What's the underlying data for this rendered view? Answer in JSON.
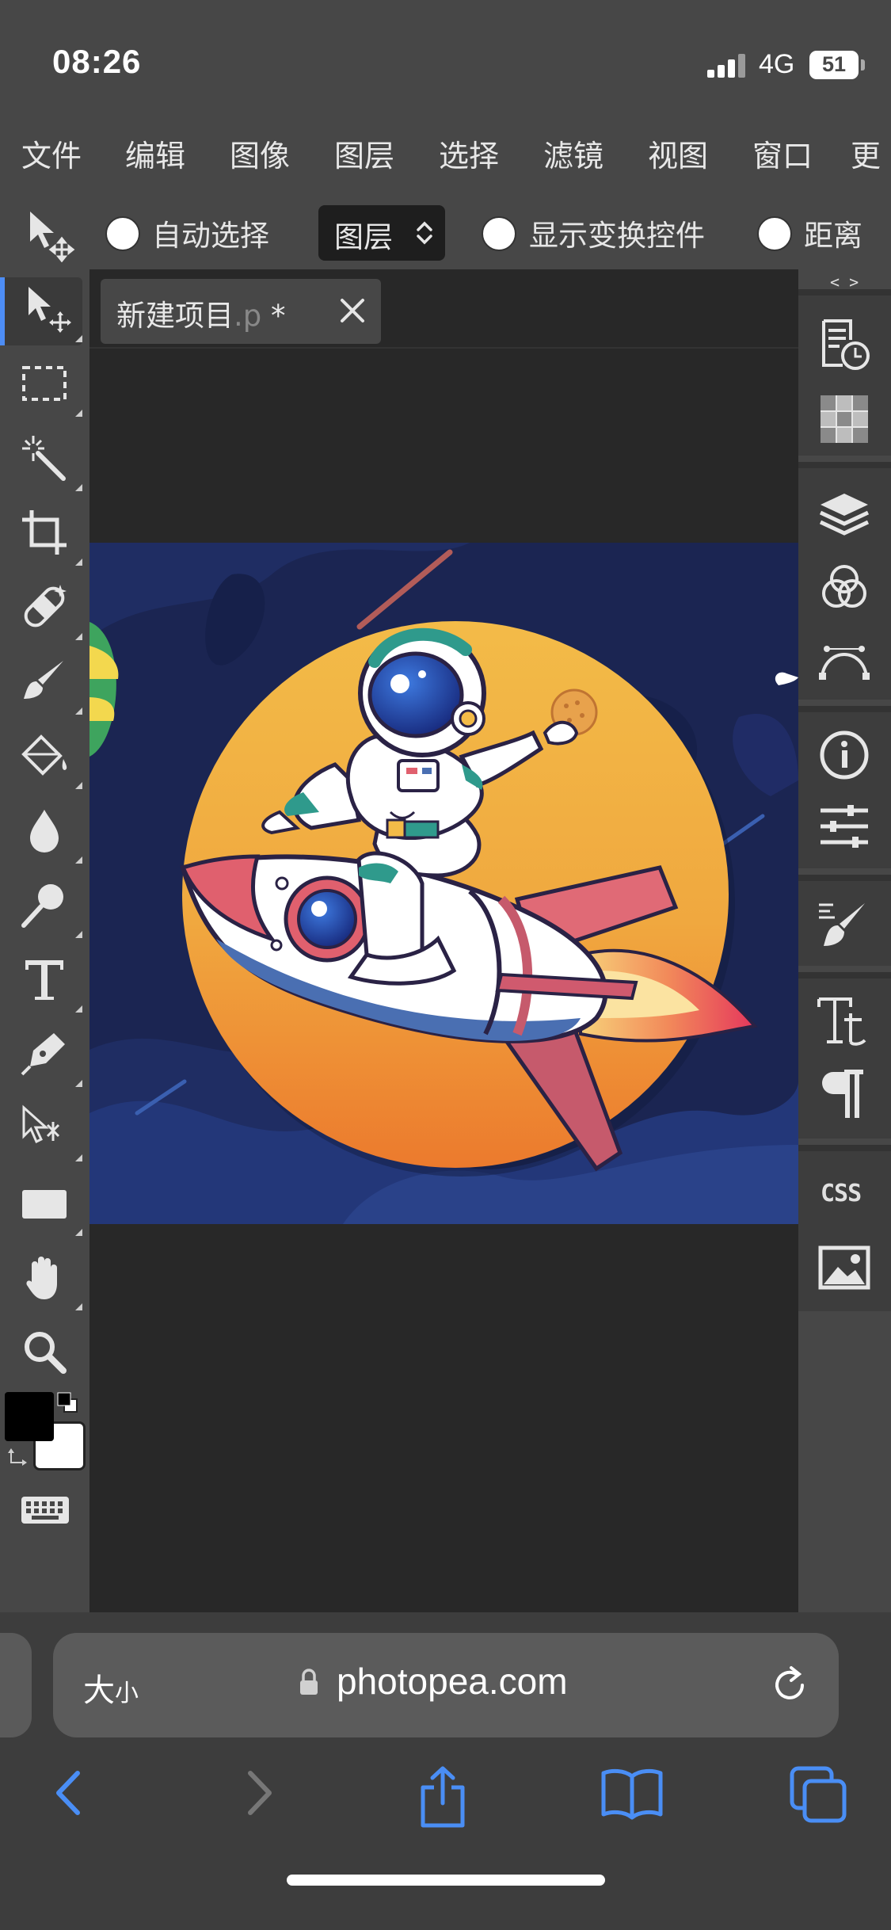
{
  "status_bar": {
    "time": "08:26",
    "network": "4G",
    "battery": "51"
  },
  "menu": {
    "items": [
      "文件",
      "编辑",
      "图像",
      "图层",
      "选择",
      "滤镜",
      "视图",
      "窗口",
      "更"
    ]
  },
  "options_bar": {
    "auto_select_label": "自动选择",
    "auto_select_checked": false,
    "target_select_value": "图层",
    "show_transform_label": "显示变换控件",
    "show_transform_checked": false,
    "distance_label": "距离",
    "distance_checked": false
  },
  "toolbar": {
    "tools": [
      "move-tool",
      "marquee-tool",
      "magic-wand-tool",
      "crop-tool",
      "healing-tool",
      "brush-tool",
      "paint-bucket-tool",
      "blur-tool",
      "dodge-tool",
      "type-tool",
      "pen-tool",
      "path-select-tool",
      "rectangle-tool",
      "hand-tool",
      "zoom-tool"
    ],
    "active_tool": "move-tool",
    "foreground_color": "#000000",
    "background_color": "#ffffff"
  },
  "document": {
    "tab_name": "新建项目",
    "tab_ext": ".p",
    "tab_modified": " *"
  },
  "right_panel": {
    "toggle": "< >",
    "buttons": [
      "history-icon",
      "swatches-icon",
      "layers-icon",
      "channels-icon",
      "paths-icon",
      "info-icon",
      "adjustments-icon",
      "brush-settings-icon",
      "character-icon",
      "paragraph-icon",
      "css-icon",
      "image-icon"
    ],
    "css_label": "CSS"
  },
  "browser": {
    "text_size_label": "大",
    "text_size_small": "小",
    "url": "photopea.com"
  },
  "colors": {
    "ui_bg": "#474747",
    "workspace_bg": "#282828",
    "accent": "#4d8df5",
    "artwork_navy": "#1b2552",
    "artwork_sun": "#f2b743"
  }
}
